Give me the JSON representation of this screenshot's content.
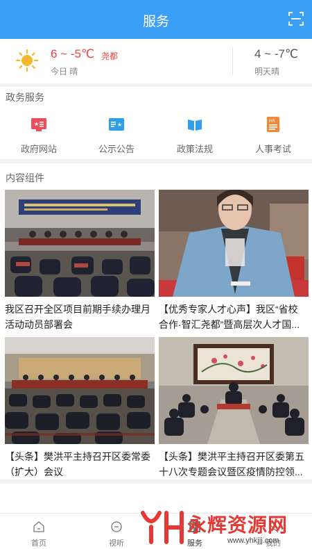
{
  "header": {
    "title": "服务"
  },
  "weather": {
    "today_temp": "6 ~ -5℃",
    "city": "尧都",
    "today_label": "今日 晴",
    "tomorrow_temp": "4 ~ -7℃",
    "tomorrow_label": "明天晴"
  },
  "gov_section": {
    "title": "政务服务"
  },
  "services": [
    {
      "label": "政府网站",
      "icon": "government-website-icon",
      "color": "#ec4f5b"
    },
    {
      "label": "公示公告",
      "icon": "announcement-icon",
      "color": "#2e9fe8"
    },
    {
      "label": "政策法规",
      "icon": "book-icon",
      "color": "#2e9fe8"
    },
    {
      "label": "人事考试",
      "icon": "exam-icon",
      "color": "#f08a3a"
    }
  ],
  "content_section": {
    "title": "内容组件"
  },
  "articles": [
    {
      "line1": "我区召开全区项目前期手续办理月",
      "line2": "活动动员部署会"
    },
    {
      "line1": "【优秀专家人才心声】我区“省校",
      "line2": "合作·智汇尧都”暨高层次人才国..."
    },
    {
      "line1": "【头条】樊洪平主持召开区委常委",
      "line2": "（扩大）会议"
    },
    {
      "line1": "【头条】樊洪平主持召开区委第五",
      "line2": "十八次专题会议暨区疫情防控领..."
    }
  ],
  "tabs": [
    {
      "label": "首页",
      "icon": "home-icon"
    },
    {
      "label": "视听",
      "icon": "play-icon"
    },
    {
      "label": "服务",
      "icon": "services-icon"
    },
    {
      "label": "我的",
      "icon": "user-icon"
    }
  ],
  "watermark": {
    "brand": "永辉资源网",
    "url": "www.yhkjjj.com"
  },
  "colors": {
    "accent": "#3b9ff5",
    "temp_red": "#e84545"
  }
}
